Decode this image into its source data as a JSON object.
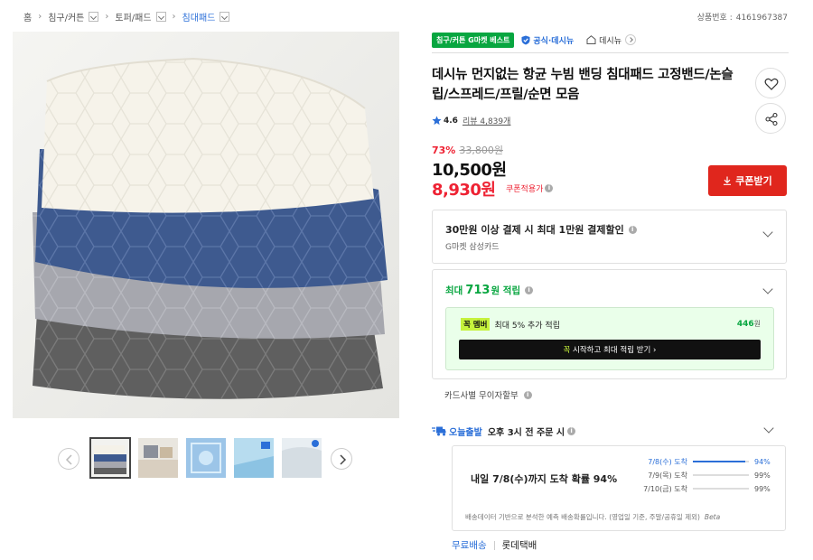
{
  "breadcrumb": {
    "home": "홈",
    "items": [
      "침구/커튼",
      "토퍼/패드",
      "침대패드"
    ]
  },
  "product_number": {
    "label": "상품번호 :",
    "value": "4161967387"
  },
  "badges": {
    "best": "침구/커튼 G마켓 베스트",
    "official": "공식·데시뉴",
    "shop": "데시뉴"
  },
  "title": "데시뉴 먼지없는 항균 누빔 밴딩 침대패드 고정밴드/논슬립/스프레드/프릴/순면 모음",
  "rating": {
    "score": "4.6",
    "reviews": "리뷰 4,839개"
  },
  "price": {
    "discount": "73%",
    "original": "33,800원",
    "sale": "10,500원",
    "coupon_price": "8,930원",
    "coupon_label": "쿠폰적용가",
    "coupon_button": "쿠폰받기"
  },
  "card_payment": {
    "title": "30만원 이상 결제 시 최대 1만원 결제할인",
    "subtitle": "G마켓 삼성카드"
  },
  "points": {
    "prefix": "최대",
    "amount": "713",
    "suffix": "원 적립",
    "member_badge": "멤버",
    "member_badge_prefix": "꼭",
    "member_text": "최대 5% 추가 적립",
    "member_points": "446",
    "member_points_unit": "원",
    "cta_prefix": "꼭",
    "cta_text": "시작하고 최대 적립 받기 ›"
  },
  "installment": "카드사별 무이자할부",
  "delivery": {
    "badge": "오늘출발",
    "when": "오후 3시 전 주문 시",
    "probability": "내일 7/8(수)까지 도착 확률 94%",
    "rows": [
      {
        "label": "7/8(수) 도착",
        "pct": "94%",
        "value": 94
      },
      {
        "label": "7/9(목) 도착",
        "pct": "99%",
        "value": 99
      },
      {
        "label": "7/10(금) 도착",
        "pct": "99%",
        "value": 99
      }
    ],
    "note": "배송데이터 기반으로 분석한 예측 배송확률입니다. (영업일 기준, 주말/공휴일 제외)",
    "beta": "Beta"
  },
  "shipping": {
    "free": "무료배송",
    "carrier": "롯데택배"
  },
  "colors": {
    "accent_red": "#e0261d",
    "accent_green": "#08a640",
    "accent_blue": "#2b6fd8"
  }
}
